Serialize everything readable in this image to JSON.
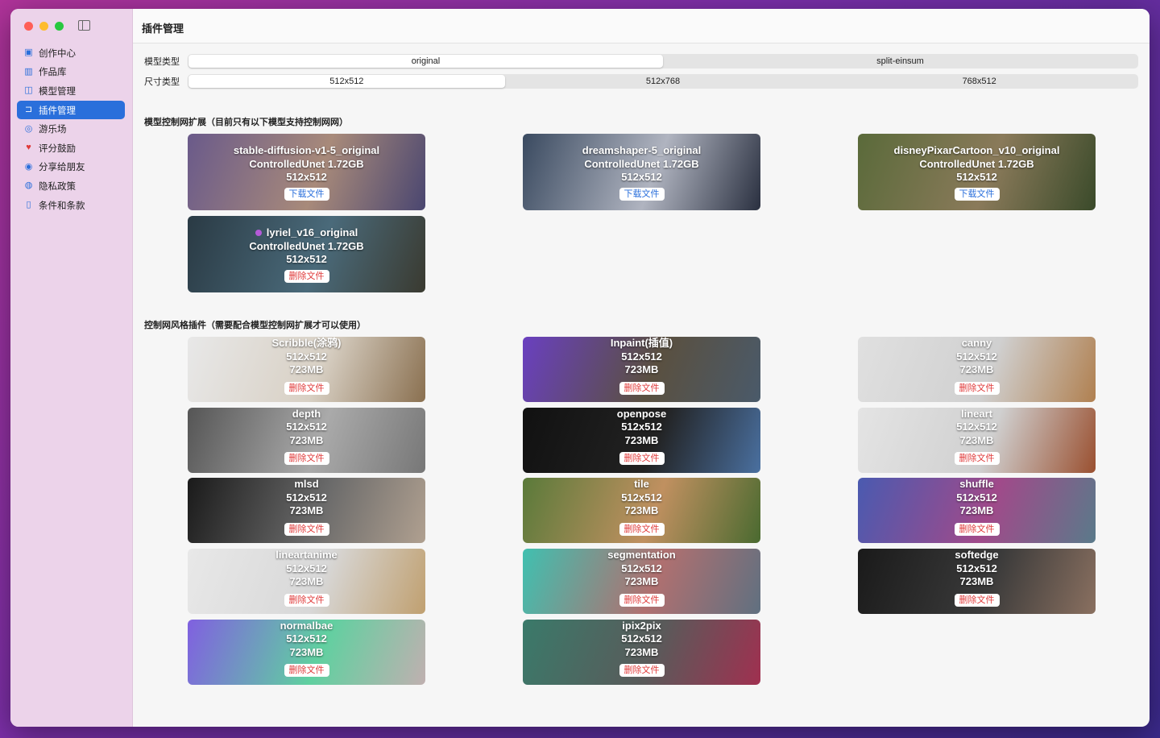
{
  "window": {
    "title": "插件管理"
  },
  "sidebar": {
    "items": [
      {
        "label": "创作中心",
        "icon": "photo-icon",
        "glyph": "▣"
      },
      {
        "label": "作品库",
        "icon": "library-icon",
        "glyph": "▥"
      },
      {
        "label": "模型管理",
        "icon": "cpu-icon",
        "glyph": "◫"
      },
      {
        "label": "插件管理",
        "icon": "plugin-icon",
        "glyph": "⊐",
        "active": true
      },
      {
        "label": "游乐场",
        "icon": "palette-icon",
        "glyph": "◎"
      },
      {
        "label": "评分鼓励",
        "icon": "heart-icon",
        "glyph": "♥"
      },
      {
        "label": "分享给朋友",
        "icon": "share-icon",
        "glyph": "◉"
      },
      {
        "label": "隐私政策",
        "icon": "lock-shield-icon",
        "glyph": "◍"
      },
      {
        "label": "条件和条款",
        "icon": "document-icon",
        "glyph": "▯"
      }
    ]
  },
  "filters": {
    "model_type": {
      "label": "模型类型",
      "options": [
        "original",
        "split-einsum"
      ],
      "selected": 0
    },
    "size_type": {
      "label": "尺寸类型",
      "options": [
        "512x512",
        "512x768",
        "768x512"
      ],
      "selected": 0
    }
  },
  "models_section": {
    "title": "模型控制网扩展（目前只有以下模型支持控制网网）",
    "items": [
      {
        "name": "stable-diffusion-v1-5_original",
        "detail": "ControlledUnet 1.72GB",
        "size": "512x512",
        "action": "下载文件",
        "kind": "dl",
        "colors": [
          "#6a5a8a",
          "#a88a7a",
          "#4a4670"
        ]
      },
      {
        "name": "dreamshaper-5_original",
        "detail": "ControlledUnet 1.72GB",
        "size": "512x512",
        "action": "下载文件",
        "kind": "dl",
        "colors": [
          "#3a4a60",
          "#b0b4c0",
          "#2a3040"
        ]
      },
      {
        "name": "disneyPixarCartoon_v10_original",
        "detail": "ControlledUnet 1.72GB",
        "size": "512x512",
        "action": "下载文件",
        "kind": "dl",
        "colors": [
          "#5a6a3a",
          "#8a7a5a",
          "#3a4a2a"
        ]
      },
      {
        "name": "lyriel_v16_original",
        "detail": "ControlledUnet 1.72GB",
        "size": "512x512",
        "action": "删除文件",
        "kind": "del",
        "active": true,
        "colors": [
          "#2a3a44",
          "#4a6a7a",
          "#3a3a30"
        ]
      }
    ]
  },
  "plugins_section": {
    "title": "控制网风格插件（需要配合模型控制网扩展才可以使用）",
    "items": [
      {
        "name": "Scribble(涂鸦)",
        "size": "512x512",
        "file": "723MB",
        "action": "删除文件",
        "colors": [
          "#e8e8e8",
          "#d8d0c4",
          "#8a7050"
        ]
      },
      {
        "name": "Inpaint(插值)",
        "size": "512x512",
        "file": "723MB",
        "action": "删除文件",
        "colors": [
          "#6a40c0",
          "#5a5040",
          "#4a5a6a"
        ]
      },
      {
        "name": "canny",
        "size": "512x512",
        "file": "723MB",
        "action": "删除文件",
        "colors": [
          "#e0e0e0",
          "#d0d0d0",
          "#b08050"
        ]
      },
      {
        "name": "depth",
        "size": "512x512",
        "file": "723MB",
        "action": "删除文件",
        "colors": [
          "#555",
          "#aaa",
          "#777"
        ]
      },
      {
        "name": "openpose",
        "size": "512x512",
        "file": "723MB",
        "action": "删除文件",
        "colors": [
          "#111",
          "#222",
          "#4a70a0"
        ]
      },
      {
        "name": "lineart",
        "size": "512x512",
        "file": "723MB",
        "action": "删除文件",
        "colors": [
          "#e4e4e4",
          "#d0d0d0",
          "#9a5030"
        ]
      },
      {
        "name": "mlsd",
        "size": "512x512",
        "file": "723MB",
        "action": "删除文件",
        "colors": [
          "#1a1a1a",
          "#6a6a6a",
          "#b0a090"
        ]
      },
      {
        "name": "tile",
        "size": "512x512",
        "file": "723MB",
        "action": "删除文件",
        "colors": [
          "#5a7a3a",
          "#c09060",
          "#4a6a30"
        ]
      },
      {
        "name": "shuffle",
        "size": "512x512",
        "file": "723MB",
        "action": "删除文件",
        "colors": [
          "#4a5ab0",
          "#a04a8a",
          "#5a7a8a"
        ]
      },
      {
        "name": "lineartanime",
        "size": "512x512",
        "file": "723MB",
        "action": "删除文件",
        "colors": [
          "#e8e8e8",
          "#d8d8d8",
          "#c0a070"
        ]
      },
      {
        "name": "segmentation",
        "size": "512x512",
        "file": "723MB",
        "action": "删除文件",
        "colors": [
          "#40c0b0",
          "#b07070",
          "#607080"
        ]
      },
      {
        "name": "softedge",
        "size": "512x512",
        "file": "723MB",
        "action": "删除文件",
        "colors": [
          "#1a1a1a",
          "#3a3a3a",
          "#8a7060"
        ]
      },
      {
        "name": "normalbae",
        "size": "512x512",
        "file": "723MB",
        "action": "删除文件",
        "colors": [
          "#8060e0",
          "#60d0a0",
          "#c0b0b0"
        ]
      },
      {
        "name": "ipix2pix",
        "size": "512x512",
        "file": "723MB",
        "action": "删除文件",
        "colors": [
          "#3a7a6a",
          "#5a5a5a",
          "#a03050"
        ]
      }
    ]
  }
}
